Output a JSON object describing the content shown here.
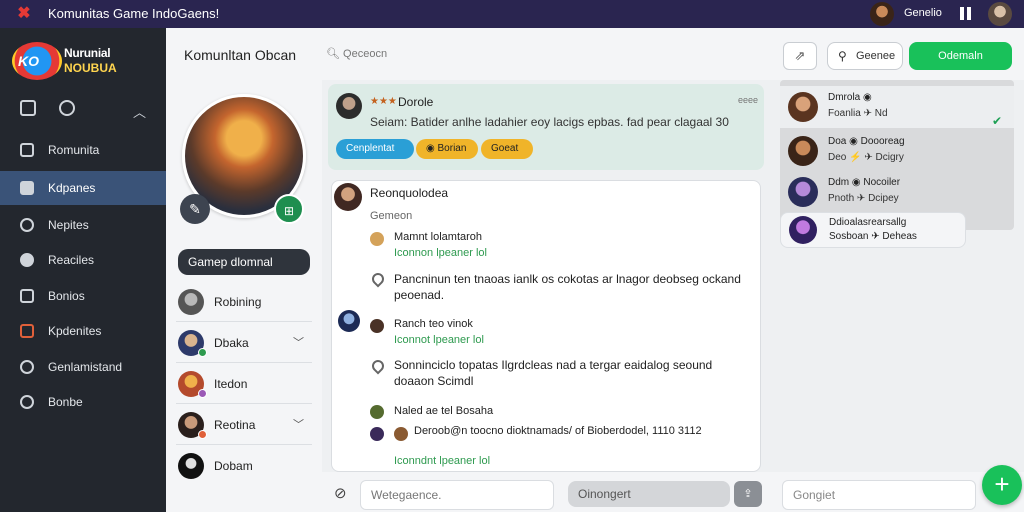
{
  "topbar": {
    "title": "Komunitas Game IndoGaens!",
    "username": "Genelio"
  },
  "sidebar": {
    "brand_line1": "Nurunial",
    "brand_line2": "NOUBUA",
    "items": [
      {
        "label": "Romunita",
        "icon": "square-icon",
        "active": false
      },
      {
        "label": "Kdpanes",
        "icon": "home-icon",
        "active": true
      },
      {
        "label": "Nepites",
        "icon": "chat-icon",
        "active": false
      },
      {
        "label": "Reaciles",
        "icon": "record-icon",
        "active": false
      },
      {
        "label": "Bonios",
        "icon": "pen-icon",
        "active": false
      },
      {
        "label": "Kpdenites",
        "icon": "shield-icon",
        "active": false
      },
      {
        "label": "Genlamistand",
        "icon": "ring-icon",
        "active": false
      },
      {
        "label": "Bonbe",
        "icon": "power-icon",
        "active": false
      }
    ]
  },
  "profile": {
    "tag": "Gamep dlomnal",
    "friends": [
      {
        "name": "Robining",
        "status_color": "#9aa0a6"
      },
      {
        "name": "Dbaka",
        "status_color": "#2e9a4f"
      },
      {
        "name": "Itedon",
        "status_color": "#9b59b6"
      },
      {
        "name": "Reotina",
        "status_color": "#e0603a"
      },
      {
        "name": "Dobam",
        "status_color": "#222222"
      }
    ]
  },
  "header": {
    "title": "Komunltan Obcan",
    "search_placeholder": "Qeceocn",
    "btn_secondary": "Geenee",
    "btn_primary": "Odemaln"
  },
  "pinned": {
    "name": "Dorole",
    "stars": "★★★",
    "time": "eeee",
    "text": "Seiam: Batider anlhe ladahier eoy lacigs epbas. fad pear clagaal 30",
    "tags": [
      "Cenplentat",
      "Borian",
      "Goeat"
    ]
  },
  "thread": {
    "title": "Reonquolodea",
    "subtitle": "Gemeon",
    "messages": [
      {
        "name": "Mamnt lolamtaroh",
        "link": "Iconnon lpeaner lol"
      },
      {
        "text": "Pancninun ten tnaoas ianlk os cokotas ar lnagor deobseg ockand peoenad."
      },
      {
        "name": "Ranch teo vinok",
        "link": "Iconnot lpeaner lol"
      },
      {
        "text": "Sonninciclo topatas Ilgrdcleas nad a tergar eaidalog seound doaaon Scimdl"
      },
      {
        "name": "Naled ae tel Bosaha"
      },
      {
        "name": "Deroob@n toocno dioktnamads/ of Bioberdodel, 1110 3112"
      },
      {
        "link": "Iconndnt lpeaner lol"
      }
    ]
  },
  "right": {
    "rows": [
      {
        "line1": "Dmrola ◉",
        "line2": "Foanlia ✈ Nd"
      },
      {
        "line1": "Doa ◉ Doooreag",
        "line2": "Deo ⚡ ✈ Dcigry"
      },
      {
        "line1": "Ddm ◉ Nocoiler",
        "line2": "Pnoth ✈ Dcipey"
      },
      {
        "line1": "Ddioalasrearsallg",
        "line2": "Sosboan ✈ Deheas"
      }
    ]
  },
  "bottom": {
    "input1_placeholder": "Wetegaence.",
    "input2_placeholder": "Oinongert",
    "input3_placeholder": "Gongiet"
  }
}
